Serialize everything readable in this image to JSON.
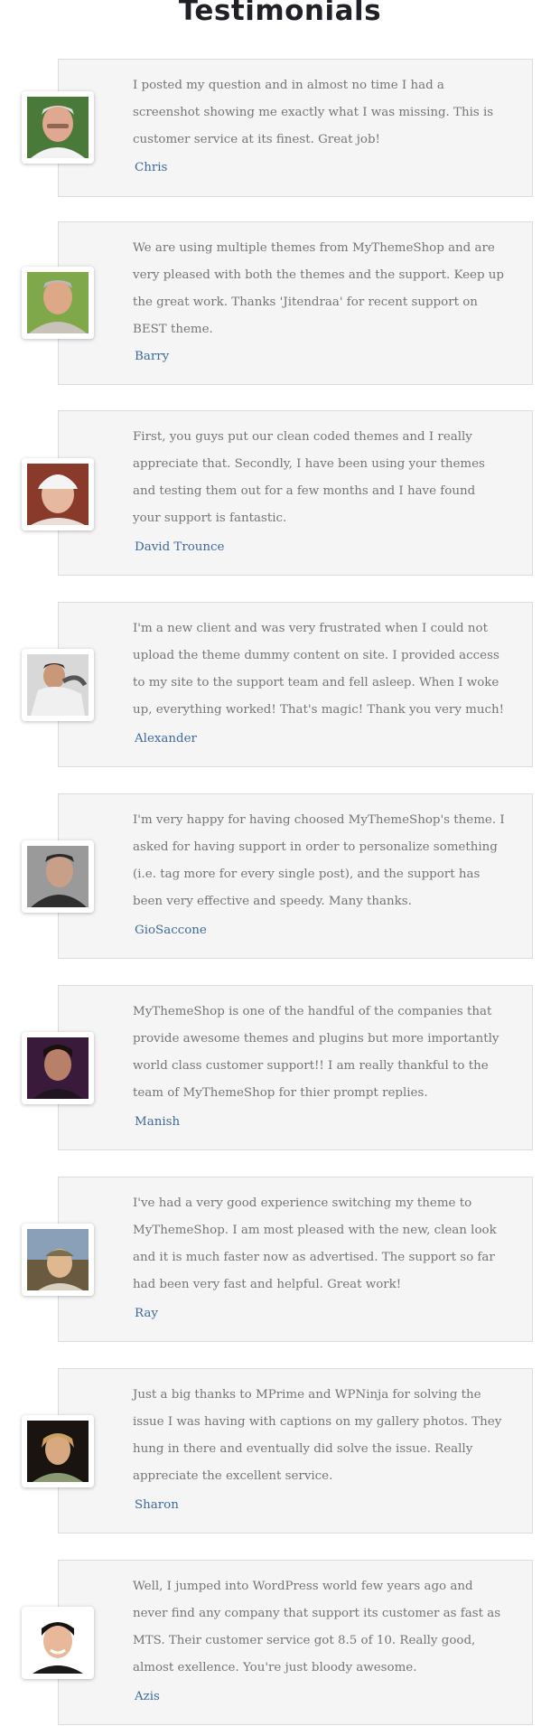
{
  "page": {
    "title": "Testimonials"
  },
  "testimonials": [
    {
      "author": "Chris",
      "text": "I posted my question and in almost no time I had a screenshot showing me exactly what I was missing. This is customer service at its finest. Great job!"
    },
    {
      "author": "Barry",
      "text": "We are using multiple themes from MyThemeShop and are very pleased with both the themes and the support. Keep up the great work. Thanks 'Jitendraa' for recent support on BEST theme."
    },
    {
      "author": "David Trounce",
      "text": "First, you guys put our clean coded themes and I really appreciate that. Secondly, I have been using your themes and testing them out for a few months and I have found your support is fantastic."
    },
    {
      "author": "Alexander",
      "text": "I'm a new client and was very frustrated when I could not upload the theme dummy content on site. I provided access to my site to the support team and fell asleep. When I woke up, everything worked! That's magic! Thank you very much!"
    },
    {
      "author": "GioSaccone",
      "text": "I'm very happy for having choosed MyThemeShop's theme. I asked for having support in order to personalize something (i.e. tag more for every single post), and the support has been very effective and speedy. Many thanks."
    },
    {
      "author": "Manish",
      "text": "MyThemeShop is one of the handful of the companies that provide awesome themes and plugins but more importantly world class customer support!! I am really thankful to the team of MyThemeShop for thier prompt replies."
    },
    {
      "author": "Ray",
      "text": "I've had a very good experience switching my theme to MyThemeShop. I am most pleased with the new, clean look and it is much faster now as advertised. The support so far had been very fast and helpful. Great work!"
    },
    {
      "author": "Sharon",
      "text": "Just a big thanks to MPrime and WPNinja for solving the issue I was having with captions on my gallery photos. They hung in there and eventually did solve the issue. Really appreciate the excellent service."
    },
    {
      "author": "Azis",
      "text": "Well, I jumped into WordPress world few years ago and never find any company that support its customer as fast as MTS. Their customer service got 8.5 of 10. Really good, almost exellence. You're just bloody awesome."
    }
  ]
}
